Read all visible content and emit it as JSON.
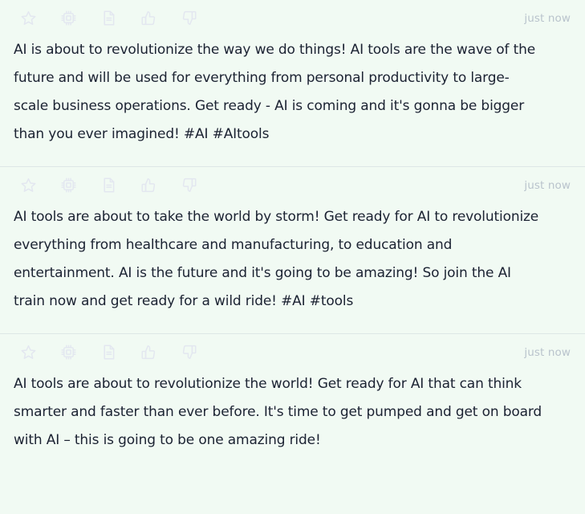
{
  "feed": {
    "actions": [
      {
        "name": "star-icon",
        "label": "Favorite"
      },
      {
        "name": "chip-icon",
        "label": "Model"
      },
      {
        "name": "document-icon",
        "label": "Document"
      },
      {
        "name": "thumbs-up-icon",
        "label": "Good response"
      },
      {
        "name": "thumbs-down-icon",
        "label": "Bad response"
      }
    ],
    "messages": [
      {
        "timestamp": "just now",
        "text": "AI is about to revolutionize the way we do things! AI tools are the wave of the future and will be used for everything from personal productivity to large-scale business operations. Get ready - AI is coming and it's gonna be bigger than you ever imagined! #AI #AItools"
      },
      {
        "timestamp": "just now",
        "text": "AI tools are about to take the world by storm! Get ready for AI to revolutionize everything from healthcare and manufacturing, to education and entertainment. AI is the future and it's going to be amazing! So join the AI train now and get ready for a wild ride! #AI #tools"
      },
      {
        "timestamp": "just now",
        "text": "AI tools are about to revolutionize the world! Get ready for AI that can think smarter and faster than ever before. It's time to get pumped and get on board with AI – this is going to be one amazing ride!"
      }
    ]
  },
  "colors": {
    "background": "#f1faf3",
    "text": "#1b2232",
    "icon": "#e3e7f0",
    "timestamp": "#b9c3cc",
    "divider": "#dde7e6"
  }
}
